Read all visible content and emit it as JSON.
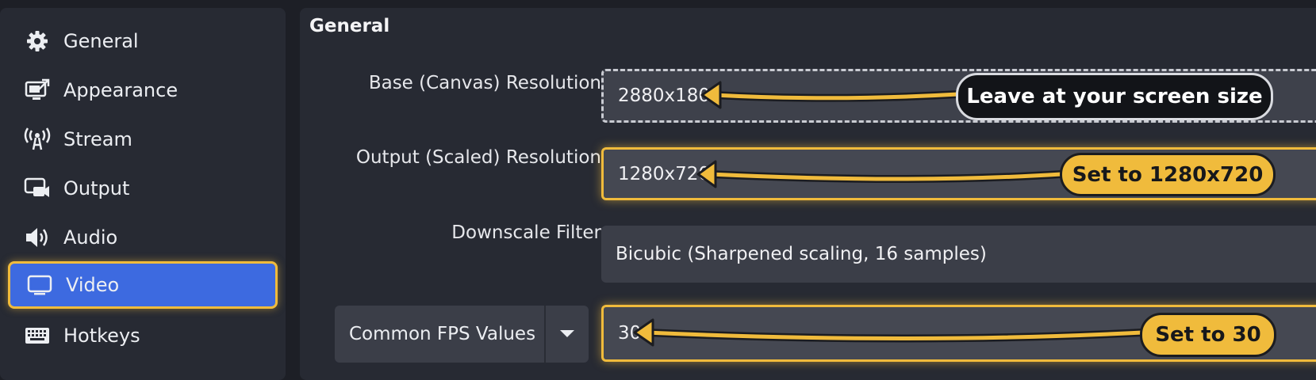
{
  "sidebar": {
    "items": [
      {
        "label": "General",
        "icon": "gear-icon",
        "active": false
      },
      {
        "label": "Appearance",
        "icon": "appearance-icon",
        "active": false
      },
      {
        "label": "Stream",
        "icon": "antenna-icon",
        "active": false
      },
      {
        "label": "Output",
        "icon": "output-icon",
        "active": false
      },
      {
        "label": "Audio",
        "icon": "speaker-icon",
        "active": false
      },
      {
        "label": "Video",
        "icon": "monitor-icon",
        "active": true
      },
      {
        "label": "Hotkeys",
        "icon": "keyboard-icon",
        "active": false
      }
    ]
  },
  "main": {
    "section_title": "General",
    "base_resolution": {
      "label": "Base (Canvas) Resolution",
      "value": "2880x1800"
    },
    "output_resolution": {
      "label": "Output (Scaled) Resolution",
      "value": "1280x720"
    },
    "downscale_filter": {
      "label": "Downscale Filter",
      "value": "Bicubic (Sharpened scaling, 16 samples)"
    },
    "fps": {
      "select_label": "Common FPS Values",
      "value": "30"
    }
  },
  "annotations": {
    "base": "Leave at your screen size",
    "output": "Set to 1280x720",
    "fps": "Set to 30"
  },
  "colors": {
    "accent_blue": "#3d6ae0",
    "highlight_gold": "#f0bb3c",
    "panel": "#272a33",
    "background": "#1d1f26"
  }
}
